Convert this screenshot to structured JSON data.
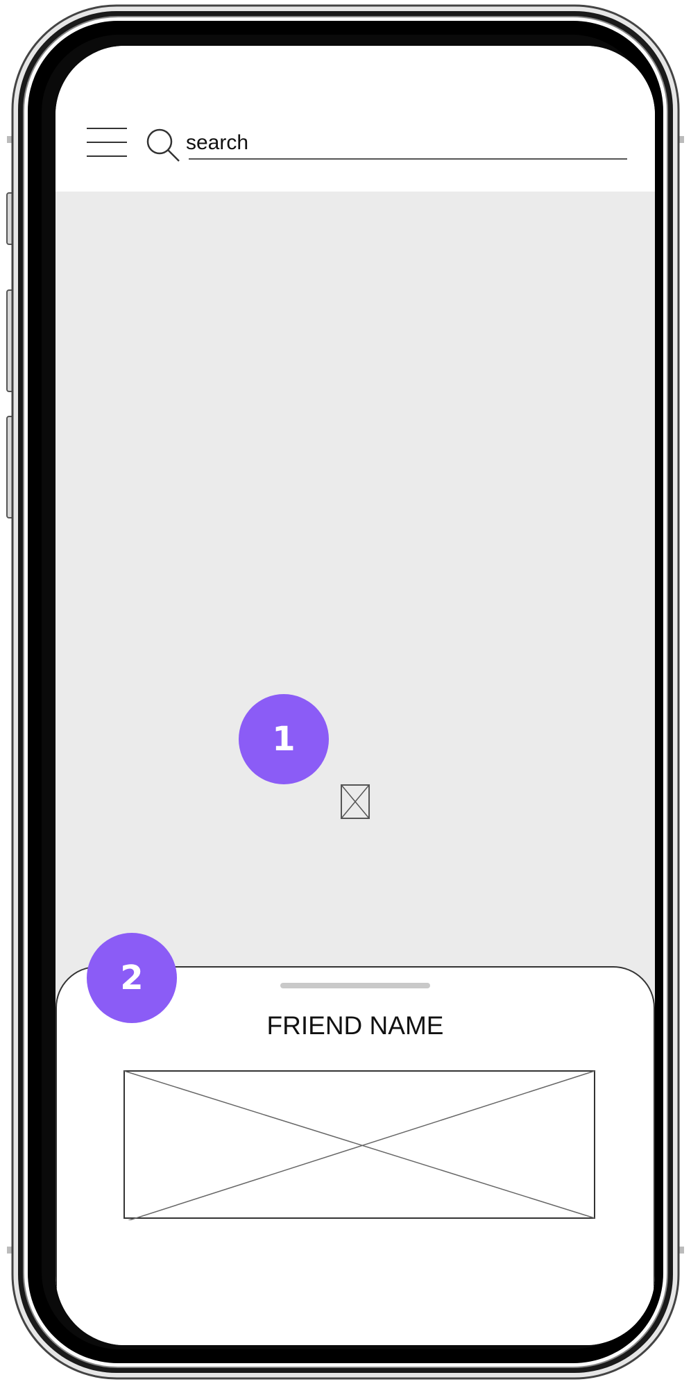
{
  "search": {
    "label": "search"
  },
  "map": {
    "badge_label": "1"
  },
  "sheet": {
    "badge_label": "2",
    "friend_name": "FRIEND NAME"
  },
  "colors": {
    "badge": "#8b5cf6",
    "map_background": "#ebebeb",
    "sheet_handle": "#c9c9c9"
  },
  "icons": {
    "menu": "hamburger-menu-icon",
    "search": "magnifier-icon",
    "map_placeholder": "image-placeholder-icon",
    "friend_image": "image-placeholder-icon"
  }
}
